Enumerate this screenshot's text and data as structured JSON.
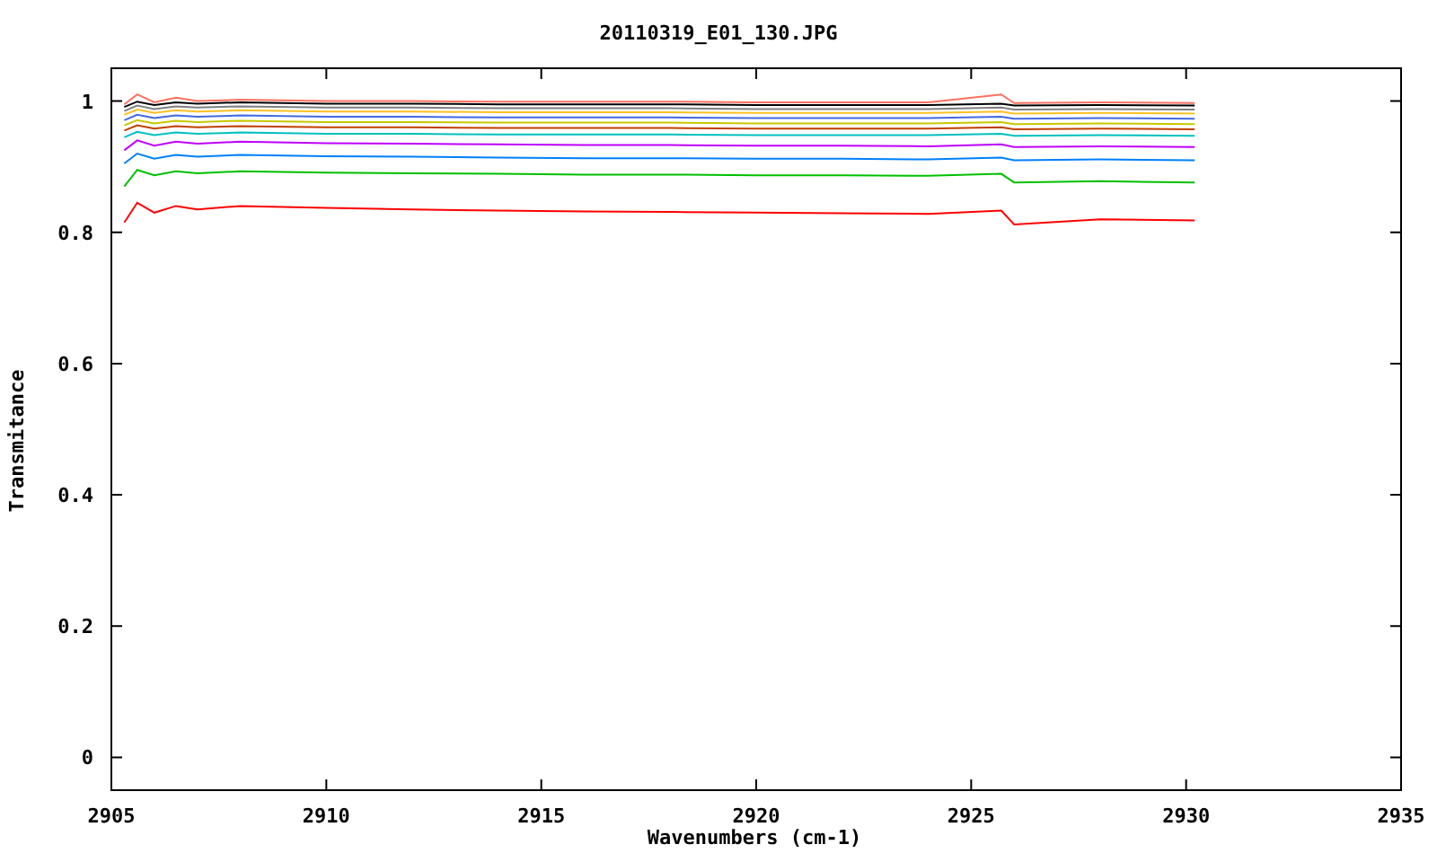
{
  "chart_data": {
    "type": "line",
    "title": "20110319_E01_130.JPG",
    "xlabel": "Wavenumbers (cm-1)",
    "ylabel": "Transmitance",
    "x": [
      2905.3,
      2905.6,
      2906,
      2906.5,
      2907,
      2908,
      2910,
      2912,
      2914,
      2916,
      2918,
      2920,
      2922,
      2924,
      2925.7,
      2926,
      2928,
      2930.2
    ],
    "xlim": [
      2905,
      2935
    ],
    "ylim": [
      -0.05,
      1.05
    ],
    "xticks": [
      2905,
      2910,
      2915,
      2920,
      2925,
      2930,
      2935
    ],
    "yticks": [
      0,
      0.2,
      0.4,
      0.6,
      0.8,
      {
        "value": 1,
        "label": "1"
      }
    ],
    "series": [
      {
        "color": "#ff0000",
        "values": [
          0.815,
          0.845,
          0.83,
          0.84,
          0.835,
          0.84,
          0.837,
          0.835,
          0.833,
          0.832,
          0.831,
          0.83,
          0.829,
          0.828,
          0.833,
          0.812,
          0.82,
          0.818
        ]
      },
      {
        "color": "#00c000",
        "values": [
          0.87,
          0.895,
          0.887,
          0.893,
          0.89,
          0.893,
          0.891,
          0.89,
          0.889,
          0.888,
          0.888,
          0.887,
          0.887,
          0.886,
          0.889,
          0.876,
          0.878,
          0.876
        ]
      },
      {
        "color": "#0080ff",
        "values": [
          0.905,
          0.92,
          0.912,
          0.918,
          0.915,
          0.918,
          0.916,
          0.915,
          0.914,
          0.913,
          0.913,
          0.912,
          0.912,
          0.911,
          0.914,
          0.91,
          0.911,
          0.91
        ]
      },
      {
        "color": "#c000ff",
        "values": [
          0.925,
          0.94,
          0.932,
          0.938,
          0.935,
          0.938,
          0.936,
          0.935,
          0.934,
          0.933,
          0.933,
          0.932,
          0.932,
          0.931,
          0.934,
          0.93,
          0.931,
          0.93
        ]
      },
      {
        "color": "#00c0c0",
        "values": [
          0.945,
          0.953,
          0.948,
          0.952,
          0.95,
          0.952,
          0.95,
          0.95,
          0.949,
          0.949,
          0.949,
          0.948,
          0.948,
          0.948,
          0.95,
          0.947,
          0.948,
          0.947
        ]
      },
      {
        "color": "#c04000",
        "values": [
          0.955,
          0.963,
          0.958,
          0.962,
          0.96,
          0.962,
          0.96,
          0.96,
          0.959,
          0.959,
          0.959,
          0.958,
          0.958,
          0.958,
          0.96,
          0.957,
          0.958,
          0.957
        ]
      },
      {
        "color": "#c8c800",
        "values": [
          0.963,
          0.971,
          0.966,
          0.97,
          0.968,
          0.97,
          0.968,
          0.968,
          0.967,
          0.967,
          0.967,
          0.966,
          0.966,
          0.966,
          0.968,
          0.965,
          0.966,
          0.965
        ]
      },
      {
        "color": "#4169e1",
        "values": [
          0.971,
          0.979,
          0.974,
          0.978,
          0.976,
          0.978,
          0.976,
          0.976,
          0.975,
          0.975,
          0.975,
          0.974,
          0.974,
          0.974,
          0.976,
          0.973,
          0.974,
          0.973
        ]
      },
      {
        "color": "#ffc020",
        "values": [
          0.979,
          0.987,
          0.982,
          0.986,
          0.984,
          0.986,
          0.984,
          0.984,
          0.983,
          0.983,
          0.983,
          0.982,
          0.982,
          0.982,
          0.984,
          0.981,
          0.982,
          0.981
        ]
      },
      {
        "color": "#808080",
        "values": [
          0.985,
          0.993,
          0.988,
          0.992,
          0.99,
          0.992,
          0.99,
          0.99,
          0.989,
          0.989,
          0.989,
          0.988,
          0.988,
          0.988,
          0.99,
          0.987,
          0.988,
          0.987
        ]
      },
      {
        "color": "#000000",
        "values": [
          0.991,
          0.999,
          0.994,
          0.998,
          0.996,
          0.998,
          0.996,
          0.996,
          0.995,
          0.995,
          0.995,
          0.994,
          0.994,
          0.994,
          0.996,
          0.993,
          0.994,
          0.993
        ]
      },
      {
        "color": "#ff7060",
        "values": [
          0.995,
          1.01,
          0.998,
          1.005,
          1.0,
          1.002,
          1.0,
          1.0,
          0.999,
          0.999,
          0.999,
          0.998,
          0.998,
          0.998,
          1.01,
          0.997,
          0.998,
          0.997
        ]
      }
    ]
  }
}
